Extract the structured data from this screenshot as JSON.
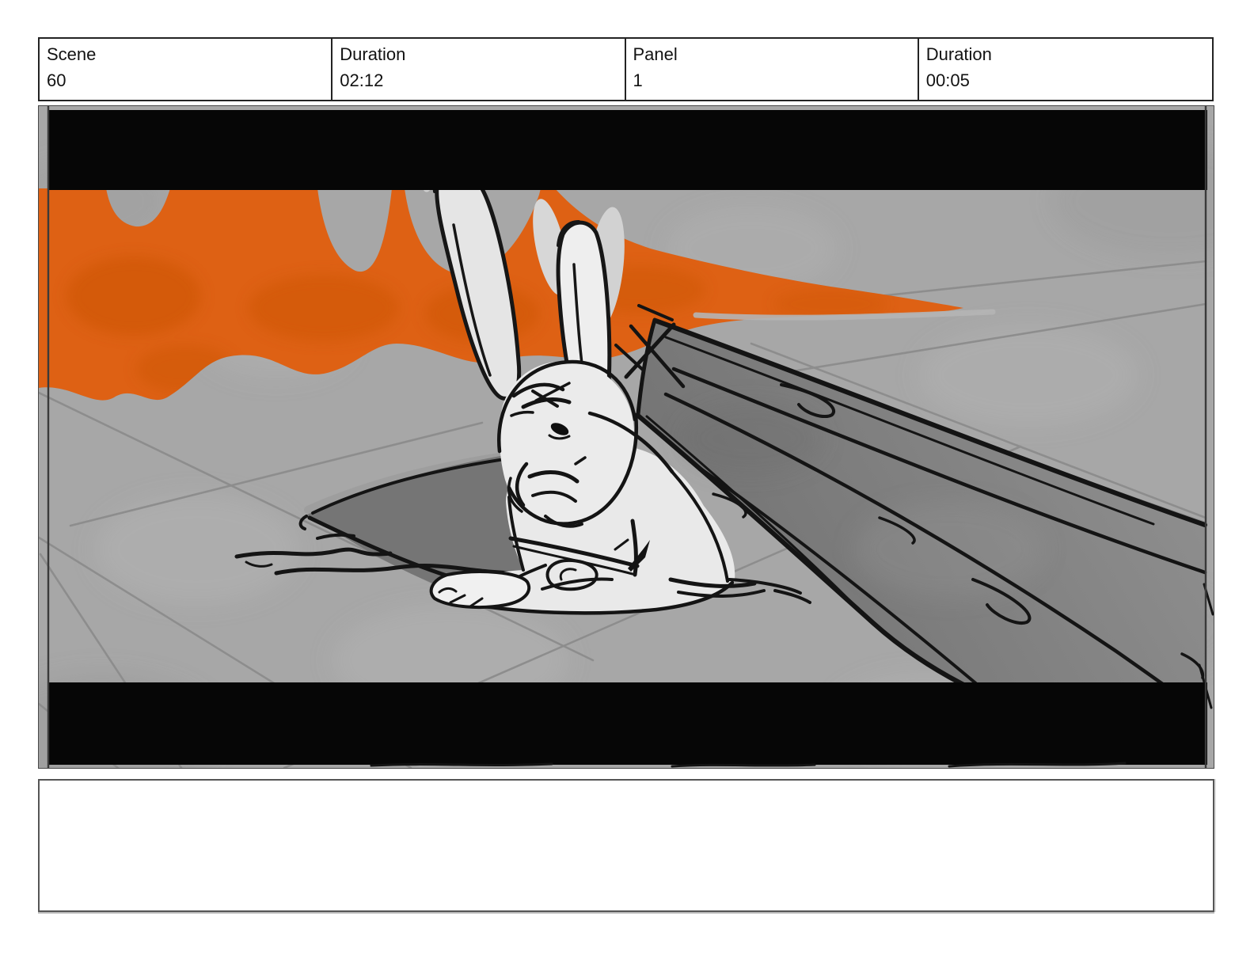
{
  "header": {
    "cells": [
      {
        "label": "Scene",
        "value": "60"
      },
      {
        "label": "Duration",
        "value": "02:12"
      },
      {
        "label": "Panel",
        "value": "1"
      },
      {
        "label": "Duration",
        "value": "00:05"
      }
    ]
  },
  "panel_image": {
    "alt": "Storyboard sketch: a worried rabbit lying on a tiled grey floor beneath a fallen wooden plank, orange flames spreading in the background, letterboxed by black cinematic bars",
    "colors": {
      "flame_orange": "#DE6114",
      "flame_orange_dark": "#C95408",
      "background_grey": "#A7A7A7",
      "plank_grey": "#7E7E7E",
      "shadow_grey": "#757575",
      "rabbit_white": "#E9E9E9",
      "letterbox_black": "#060606",
      "sketch_ink": "#141414"
    }
  },
  "notes": {
    "text": ""
  }
}
